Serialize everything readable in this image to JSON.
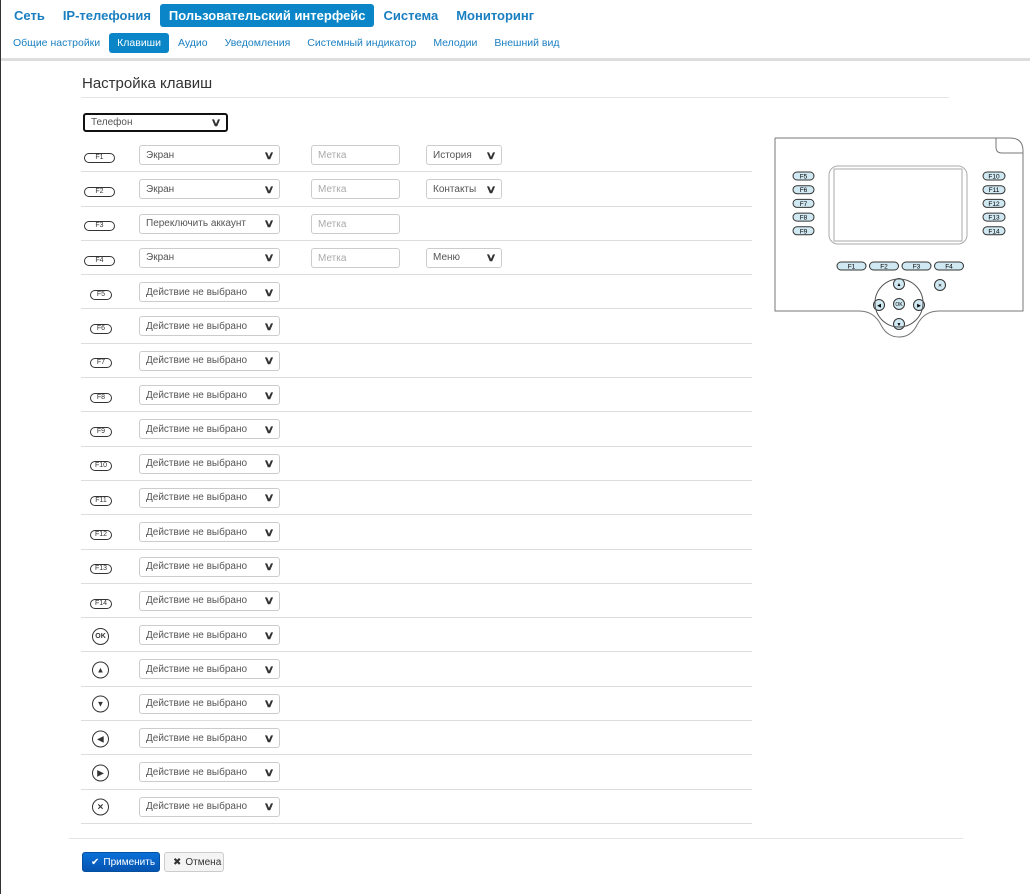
{
  "top_nav": [
    {
      "label": "Сеть"
    },
    {
      "label": "IP-телефония"
    },
    {
      "label": "Пользовательский интерфейс",
      "active": true
    },
    {
      "label": "Система"
    },
    {
      "label": "Мониторинг"
    }
  ],
  "sub_nav": [
    {
      "label": "Общие настройки"
    },
    {
      "label": "Клавиши",
      "active": true
    },
    {
      "label": "Аудио"
    },
    {
      "label": "Уведомления"
    },
    {
      "label": "Системный индикатор"
    },
    {
      "label": "Мелодии"
    },
    {
      "label": "Внешний вид"
    }
  ],
  "page_title": "Настройка клавиш",
  "mode_select": "Телефон",
  "label_placeholder": "Метка",
  "keys": [
    {
      "key": "F1",
      "type": "f",
      "action": "Экран",
      "label": true,
      "screen": "История"
    },
    {
      "key": "F2",
      "type": "f",
      "action": "Экран",
      "label": true,
      "screen": "Контакты"
    },
    {
      "key": "F3",
      "type": "f",
      "action": "Переключить аккаунт",
      "label": true
    },
    {
      "key": "F4",
      "type": "f",
      "action": "Экран",
      "label": true,
      "screen": "Меню"
    },
    {
      "key": "F5",
      "type": "side",
      "action": "Действие не выбрано"
    },
    {
      "key": "F6",
      "type": "side",
      "action": "Действие не выбрано"
    },
    {
      "key": "F7",
      "type": "side",
      "action": "Действие не выбрано"
    },
    {
      "key": "F8",
      "type": "side",
      "action": "Действие не выбрано"
    },
    {
      "key": "F9",
      "type": "side",
      "action": "Действие не выбрано"
    },
    {
      "key": "F10",
      "type": "side2",
      "action": "Действие не выбрано"
    },
    {
      "key": "F11",
      "type": "side2",
      "action": "Действие не выбрано"
    },
    {
      "key": "F12",
      "type": "side2",
      "action": "Действие не выбрано"
    },
    {
      "key": "F13",
      "type": "side2",
      "action": "Действие не выбрано"
    },
    {
      "key": "F14",
      "type": "side2",
      "action": "Действие не выбрано"
    },
    {
      "key": "OK",
      "type": "circle",
      "action": "Действие не выбрано"
    },
    {
      "key": "▲",
      "type": "circle",
      "action": "Действие не выбрано"
    },
    {
      "key": "▼",
      "type": "circle",
      "action": "Действие не выбрано"
    },
    {
      "key": "◀",
      "type": "circle",
      "action": "Действие не выбрано"
    },
    {
      "key": "▶",
      "type": "circle",
      "action": "Действие не выбрано"
    },
    {
      "key": "✕",
      "type": "circle",
      "action": "Действие не выбрано"
    }
  ],
  "phone_image": {
    "side_left": [
      "F5",
      "F6",
      "F7",
      "F8",
      "F9"
    ],
    "side_right": [
      "F10",
      "F11",
      "F12",
      "F13",
      "F14"
    ],
    "bottom": [
      "F1",
      "F2",
      "F3",
      "F4"
    ],
    "ok": "OK"
  },
  "buttons": {
    "apply": "Применить",
    "cancel": "Отмена"
  },
  "colors": {
    "accent": "#0a86c8",
    "apply": "#0560c4",
    "key_fill": "#cfe8f2"
  }
}
